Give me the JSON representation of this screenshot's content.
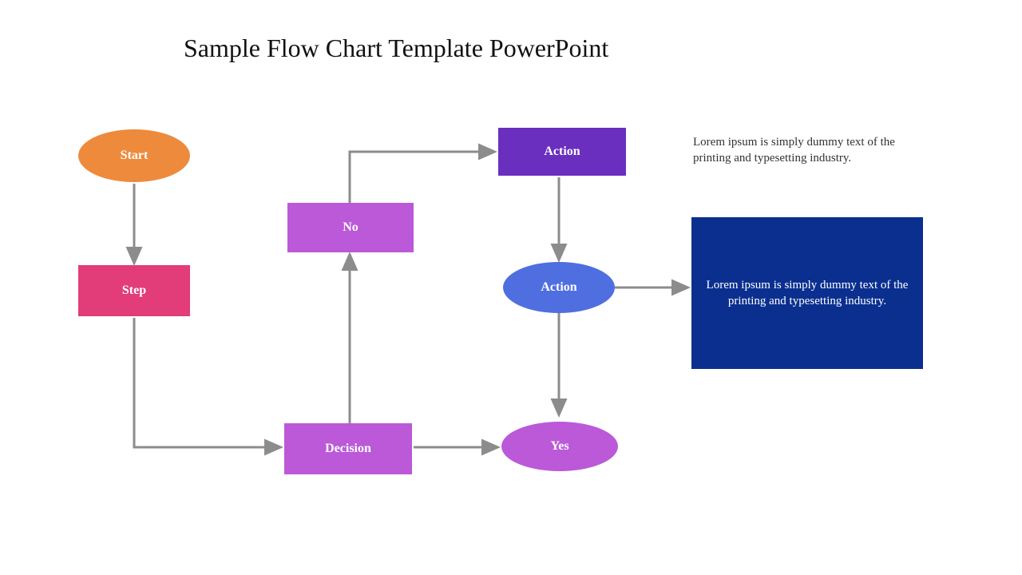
{
  "title": "Sample Flow Chart Template PowerPoint",
  "nodes": {
    "start": {
      "label": "Start"
    },
    "step": {
      "label": "Step"
    },
    "decision": {
      "label": "Decision"
    },
    "no": {
      "label": "No"
    },
    "yes": {
      "label": "Yes"
    },
    "action1": {
      "label": "Action"
    },
    "action2": {
      "label": "Action"
    }
  },
  "side_note": "Lorem ipsum is simply dummy text of the printing and typesetting industry.",
  "blue_box": "Lorem ipsum is simply dummy text of the printing and typesetting industry.",
  "colors": {
    "start": "#ee8a3c",
    "step": "#e23c79",
    "decision": "#bb59d8",
    "no": "#bb59d8",
    "yes": "#bb59d8",
    "action1": "#6a2fbf",
    "action2": "#4f6fe0",
    "bluebox": "#0a2f8f",
    "arrow": "#8c8c8c"
  }
}
